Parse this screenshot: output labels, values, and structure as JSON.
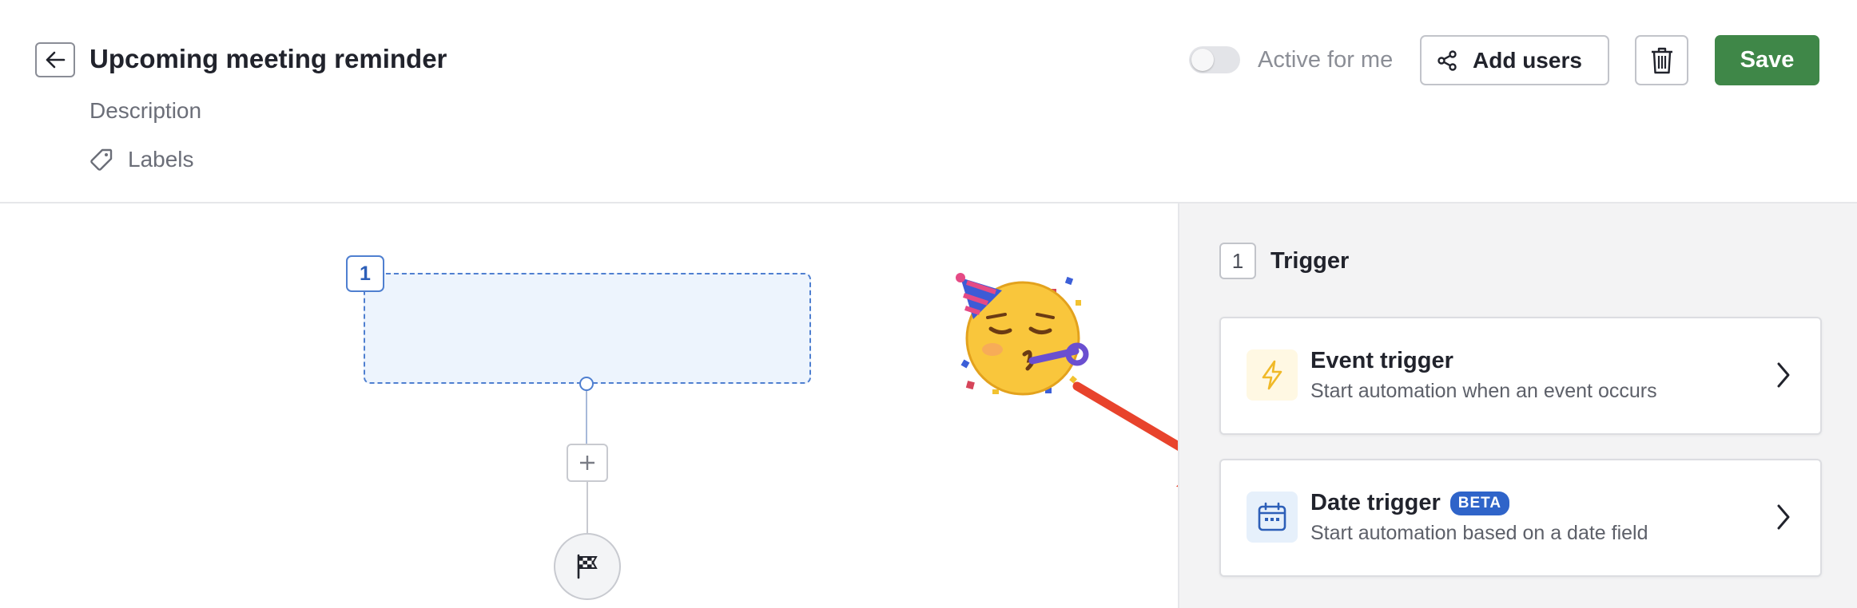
{
  "header": {
    "title": "Upcoming meeting reminder",
    "description_placeholder": "Description",
    "labels_text": "Labels",
    "toggle_label": "Active for me",
    "toggle_on": false,
    "add_users_label": "Add users",
    "save_label": "Save"
  },
  "canvas": {
    "step_number": "1"
  },
  "panel": {
    "step_number": "1",
    "title": "Trigger",
    "options": [
      {
        "title": "Event trigger",
        "subtitle": "Start automation when an event occurs",
        "icon": "lightning-icon"
      },
      {
        "title": "Date trigger",
        "badge": "BETA",
        "subtitle": "Start automation based on a date field",
        "icon": "calendar-icon"
      }
    ]
  },
  "colors": {
    "save": "#3f8748",
    "selection_border": "#4f7fd0",
    "beta_badge": "#2f64c9",
    "annotation_arrow": "#e8432c"
  }
}
